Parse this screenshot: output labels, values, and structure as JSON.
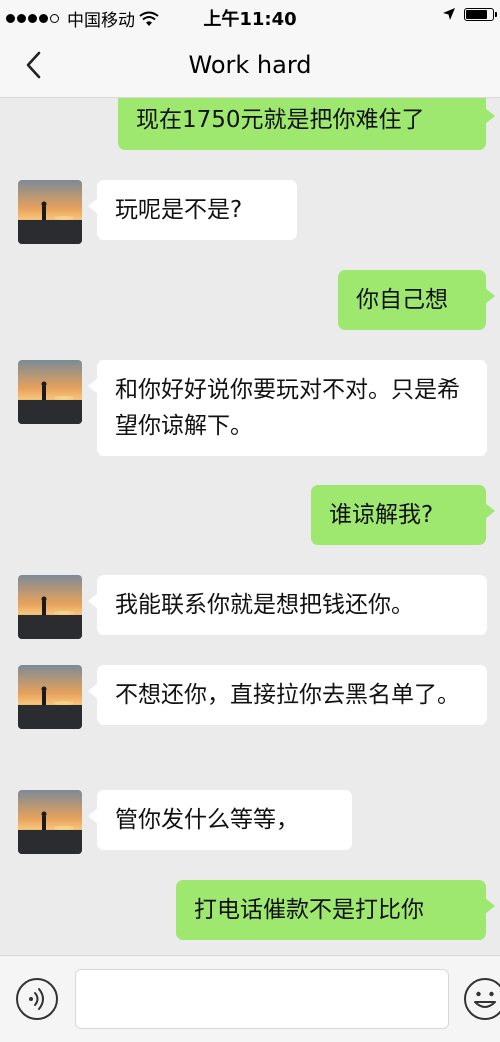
{
  "status_bar": {
    "carrier": "中国移动",
    "time": "上午11:40",
    "signal_icon": "signal-dots-icon",
    "wifi_icon": "wifi-icon",
    "location_icon": "location-arrow-icon",
    "battery_icon": "battery-icon",
    "battery_level": 0.85
  },
  "header": {
    "title": "Work hard",
    "back_icon": "chevron-left-icon"
  },
  "messages": [
    {
      "side": "out",
      "text": "现在1750元就是把你难住了"
    },
    {
      "side": "in",
      "text": "玩呢是不是?"
    },
    {
      "side": "out",
      "text": "你自己想"
    },
    {
      "side": "in",
      "text": "和你好好说你要玩对不对。只是希望你谅解下。"
    },
    {
      "side": "out",
      "text": "谁谅解我?"
    },
    {
      "side": "in",
      "text": "我能联系你就是想把钱还你。"
    },
    {
      "side": "in",
      "text": "不想还你，直接拉你去黑名单了。"
    },
    {
      "side": "in",
      "text": "管你发什么等等，"
    },
    {
      "side": "out",
      "text": "打电话催款不是打比你"
    }
  ],
  "input_bar": {
    "voice_icon": "voice-input-icon",
    "emoji_icon": "emoji-icon",
    "text_value": ""
  },
  "colors": {
    "chat_background": "#ebebeb",
    "outgoing_bubble": "#9fe870",
    "incoming_bubble": "#ffffff",
    "bar_background": "#f7f7f7"
  }
}
